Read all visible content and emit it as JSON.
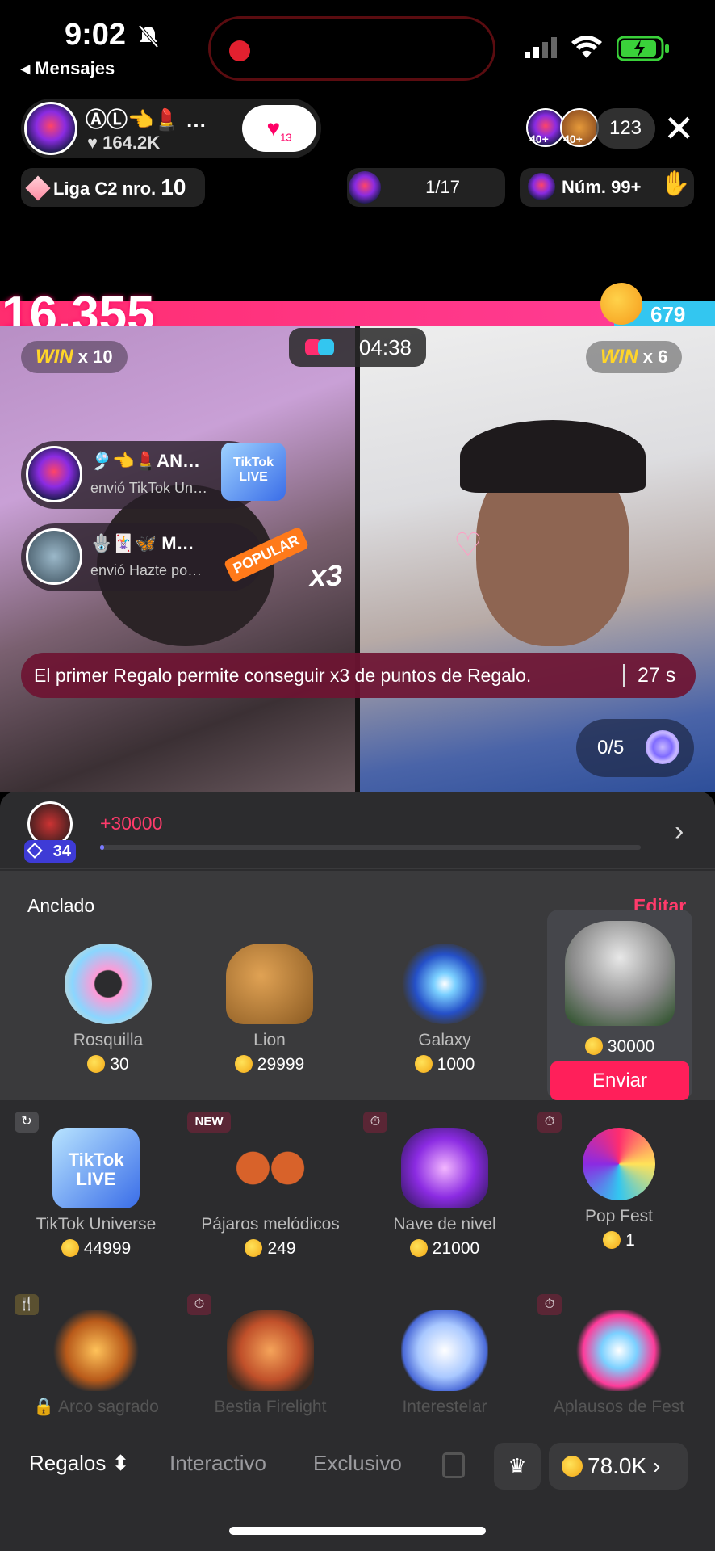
{
  "status": {
    "time": "9:02",
    "back_label": "◂ Mensajes"
  },
  "host": {
    "name": "ⒶⓁ👈💄 …",
    "likes": "♥ 164.2K",
    "like_count": "13"
  },
  "viewers": {
    "count": "123",
    "badge_a": "40+",
    "badge_b": "40+"
  },
  "chips": {
    "league_prefix": "Liga C2 nro.",
    "league_num": "10",
    "rank": "1/17",
    "num_label": "Núm. 99+"
  },
  "battle": {
    "score_left": "16,355",
    "score_right": "679",
    "timer": "04:38",
    "win_left_label": "WIN",
    "win_left_mult": "x 10",
    "win_right_label": "WIN",
    "win_right_mult": "x 6",
    "left_share": 0.96
  },
  "gift_notices": [
    {
      "name": "🎐👈💄AN…",
      "text": "envió TikTok Un…"
    },
    {
      "name": "🪬🃏🦋 M…",
      "text": "envió Hazte po…",
      "popular": "POPULAR",
      "mult": "x3"
    }
  ],
  "banner": {
    "text": "El primer Regalo permite conseguir x3 de puntos de Regalo.",
    "seconds": "27 s"
  },
  "ticket": {
    "text": "0/5"
  },
  "progress": {
    "badge": "34",
    "amount": "+30000",
    "fraction": 0.0
  },
  "pinned": {
    "title": "Anclado",
    "edit": "Editar",
    "items": [
      {
        "name": "Rosquilla",
        "price": "30"
      },
      {
        "name": "Lion",
        "price": "29999"
      },
      {
        "name": "Galaxy",
        "price": "1000"
      },
      {
        "name": "",
        "price": "30000",
        "send": "Enviar"
      }
    ]
  },
  "grid": [
    {
      "name": "TikTok Universe",
      "price": "44999",
      "tag": "↻"
    },
    {
      "name": "Pájaros melódicos",
      "price": "249",
      "tag": "NEW"
    },
    {
      "name": "Nave de nivel",
      "price": "21000",
      "tag": "⏱"
    },
    {
      "name": "Pop Fest",
      "price": "1",
      "tag": "⏱"
    },
    {
      "name": "🔒 Arco sagrado",
      "tag": "🍴"
    },
    {
      "name": "Bestia Firelight",
      "tag": "⏱"
    },
    {
      "name": "Interestelar"
    },
    {
      "name": "Aplausos de Fest",
      "tag": "⏱"
    }
  ],
  "tabs": {
    "gifts": "Regalos ⬍",
    "interactive": "Interactivo",
    "exclusive": "Exclusivo"
  },
  "balance": {
    "amount": "78.0K"
  }
}
